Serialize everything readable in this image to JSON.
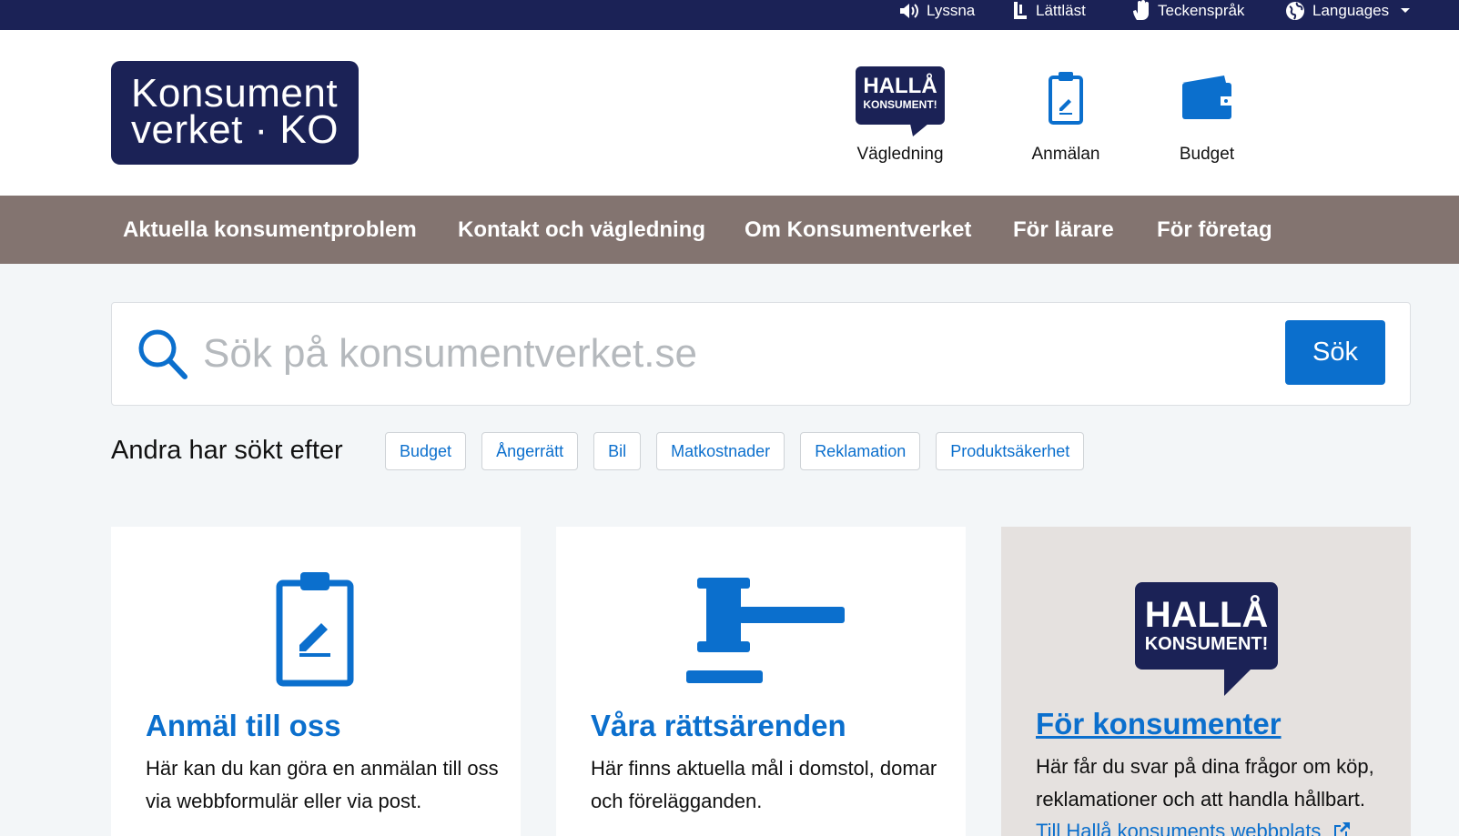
{
  "topbar": {
    "listen": "Lyssna",
    "easy_read": "Lättläst",
    "sign_language": "Teckenspråk",
    "languages": "Languages"
  },
  "logo": {
    "line1": "Konsument",
    "line2": "verket · KO"
  },
  "header_links": [
    {
      "label": "Vägledning",
      "icon": "halla-konsument-logo"
    },
    {
      "label": "Anmälan",
      "icon": "clipboard-edit-icon"
    },
    {
      "label": "Budget",
      "icon": "wallet-icon"
    }
  ],
  "halla_badge": {
    "line1": "HALLÅ",
    "line2": "KONSUMENT!"
  },
  "nav": [
    "Aktuella konsumentproblem",
    "Kontakt och vägledning",
    "Om Konsumentverket",
    "För lärare",
    "För företag"
  ],
  "search": {
    "placeholder": "Sök på konsumentverket.se",
    "button": "Sök"
  },
  "popular": {
    "label": "Andra har sökt efter",
    "tags": [
      "Budget",
      "Ångerrätt",
      "Bil",
      "Matkostnader",
      "Reklamation",
      "Produktsäkerhet"
    ]
  },
  "cards": [
    {
      "title": "Anmäl till oss",
      "desc": "Här kan du kan göra en anmälan till oss via webbformulär eller via post."
    },
    {
      "title": "Våra rättsärenden",
      "desc": "Här finns aktuella mål i domstol, domar och förelägganden."
    },
    {
      "title": "För konsumenter",
      "desc": "Här får du svar på dina frågor om köp, reklamationer och att handla hållbart.",
      "link": "Till Hallå konsuments webbplats"
    }
  ],
  "colors": {
    "navy": "#1b2256",
    "blue": "#0b6fcd",
    "nav_bg": "#837470",
    "page_bg": "#f3f6f8",
    "card_gray": "#e5e1df"
  }
}
